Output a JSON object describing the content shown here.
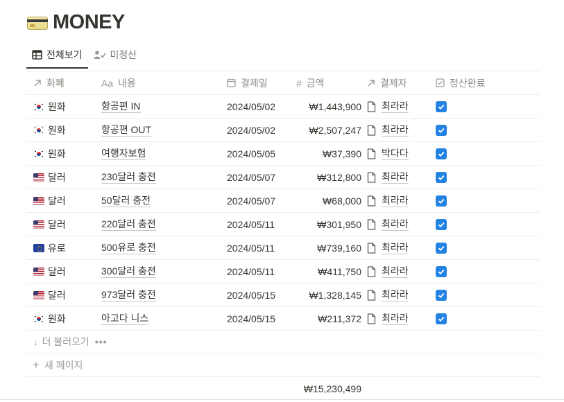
{
  "page": {
    "title": "MONEY",
    "icon": "credit-card-icon"
  },
  "tabs": [
    {
      "label": "전체보기",
      "icon": "table-icon",
      "active": true
    },
    {
      "label": "미정산",
      "icon": "person-check-icon",
      "active": false
    }
  ],
  "columns": {
    "currency": {
      "label": "화폐",
      "icon": "relation-arrow-icon"
    },
    "content": {
      "label": "내용",
      "icon": "Aa"
    },
    "date": {
      "label": "결제일",
      "icon": "calendar-icon"
    },
    "amount": {
      "label": "금액",
      "icon": "#"
    },
    "payer": {
      "label": "결제자",
      "icon": "relation-arrow-icon"
    },
    "settled": {
      "label": "정산완료",
      "icon": "checkbox-icon"
    }
  },
  "rows": [
    {
      "flag": "kr",
      "currency": "원화",
      "content": "항공편 IN",
      "date": "2024/05/02",
      "amount": "₩1,443,900",
      "payer": "최라라",
      "settled": true
    },
    {
      "flag": "kr",
      "currency": "원화",
      "content": "항공편 OUT",
      "date": "2024/05/02",
      "amount": "₩2,507,247",
      "payer": "최라라",
      "settled": true
    },
    {
      "flag": "kr",
      "currency": "원화",
      "content": "여행자보험",
      "date": "2024/05/05",
      "amount": "₩37,390",
      "payer": "박다다",
      "settled": true
    },
    {
      "flag": "us",
      "currency": "달러",
      "content": "230달러 충전",
      "date": "2024/05/07",
      "amount": "₩312,800",
      "payer": "최라라",
      "settled": true
    },
    {
      "flag": "us",
      "currency": "달러",
      "content": "50달러 충전",
      "date": "2024/05/07",
      "amount": "₩68,000",
      "payer": "최라라",
      "settled": true
    },
    {
      "flag": "us",
      "currency": "달러",
      "content": "220달러 충전",
      "date": "2024/05/11",
      "amount": "₩301,950",
      "payer": "최라라",
      "settled": true
    },
    {
      "flag": "eu",
      "currency": "유로",
      "content": "500유로 충전",
      "date": "2024/05/11",
      "amount": "₩739,160",
      "payer": "최라라",
      "settled": true
    },
    {
      "flag": "us",
      "currency": "달러",
      "content": "300달러 충전",
      "date": "2024/05/11",
      "amount": "₩411,750",
      "payer": "최라라",
      "settled": true
    },
    {
      "flag": "us",
      "currency": "달러",
      "content": "973달러 충전",
      "date": "2024/05/15",
      "amount": "₩1,328,145",
      "payer": "최라라",
      "settled": true
    },
    {
      "flag": "kr",
      "currency": "원화",
      "content": "아고다 니스",
      "date": "2024/05/15",
      "amount": "₩211,372",
      "payer": "최라라",
      "settled": true
    }
  ],
  "load_more": {
    "label": "더 불러오기",
    "more": "•••"
  },
  "new_page": {
    "label": "새 페이지"
  },
  "sum": {
    "amount": "₩15,230,499"
  },
  "colors": {
    "accent": "#2383e2",
    "text": "#37352f",
    "muted": "#9b9a97"
  }
}
